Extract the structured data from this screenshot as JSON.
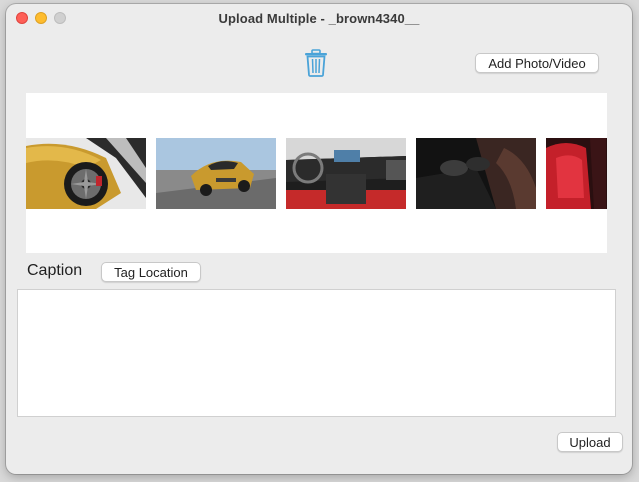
{
  "window": {
    "title": "Upload Multiple - _brown4340__"
  },
  "toolbar": {
    "trash_icon": "trash-icon",
    "add_label": "Add Photo/Video"
  },
  "media_strip": {
    "items": [
      {
        "name": "gold-car-wheel-photo"
      },
      {
        "name": "gold-car-road-photo"
      },
      {
        "name": "car-dashboard-photo"
      },
      {
        "name": "car-center-console-photo"
      },
      {
        "name": "red-car-seats-photo"
      }
    ]
  },
  "caption": {
    "label": "Caption",
    "tag_location_label": "Tag Location",
    "value": ""
  },
  "footer": {
    "upload_label": "Upload"
  },
  "colors": {
    "accent": "#4aa3d8",
    "close": "#fe5f57",
    "minimize": "#febc2e"
  }
}
